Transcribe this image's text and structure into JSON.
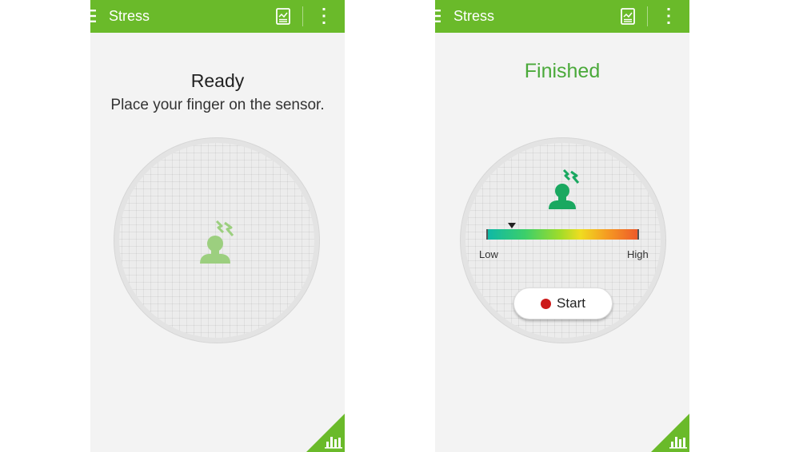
{
  "app": {
    "title": "Stress"
  },
  "icons": {
    "menu": "menu-icon",
    "report": "report-icon",
    "more": "more-vert-icon",
    "stress": "stressed-head-icon",
    "chart": "bar-chart-icon"
  },
  "colors": {
    "appbar": "#6aba2a",
    "finished_text": "#4aa93a",
    "stress_icon_idle": "#9ccf7f",
    "stress_icon_active": "#1aa860",
    "record_dot": "#cc1a1a"
  },
  "ready_screen": {
    "status_title": "Ready",
    "instruction": "Place your finger on the sensor."
  },
  "result_screen": {
    "status_title": "Finished",
    "scale": {
      "low_label": "Low",
      "high_label": "High",
      "level_fraction": 0.17
    },
    "start_button": {
      "label": "Start"
    }
  }
}
